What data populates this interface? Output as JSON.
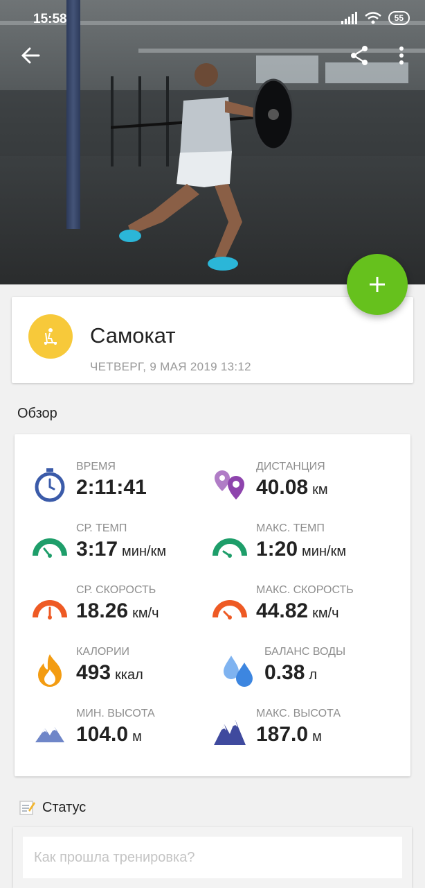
{
  "status_bar": {
    "time": "15:58",
    "battery": "55"
  },
  "header": {
    "back_icon": "arrow-left-icon",
    "share_icon": "share-icon",
    "more_icon": "more-vertical-icon"
  },
  "fab": {
    "icon": "plus-icon",
    "color": "#66c11d"
  },
  "activity": {
    "title": "Самокат",
    "date": "ЧЕТВЕРГ, 9 МАЯ 2019 13:12",
    "icon": "kick-scooter-icon",
    "icon_color": "#f7c93a"
  },
  "overview": {
    "title": "Обзор",
    "stats": [
      {
        "label": "ВРЕМЯ",
        "value": "2:11:41",
        "unit": "",
        "icon": "stopwatch-icon"
      },
      {
        "label": "ДИСТАНЦИЯ",
        "value": "40.08",
        "unit": "км",
        "icon": "map-pins-icon"
      },
      {
        "label": "СР. ТЕМП",
        "value": "3:17",
        "unit": "мин/км",
        "icon": "pace-gauge-icon"
      },
      {
        "label": "МАКС. ТЕМП",
        "value": "1:20",
        "unit": "мин/км",
        "icon": "pace-gauge-icon"
      },
      {
        "label": "СР. СКОРОСТЬ",
        "value": "18.26",
        "unit": "км/ч",
        "icon": "speed-gauge-icon"
      },
      {
        "label": "МАКС. СКОРОСТЬ",
        "value": "44.82",
        "unit": "км/ч",
        "icon": "speed-gauge-icon"
      },
      {
        "label": "КАЛОРИИ",
        "value": "493",
        "unit": "ккал",
        "icon": "flame-icon"
      },
      {
        "label": "БАЛАНС ВОДЫ",
        "value": "0.38",
        "unit": "л",
        "icon": "water-drops-icon"
      },
      {
        "label": "МИН. ВЫСОТА",
        "value": "104.0",
        "unit": "м",
        "icon": "mountain-icon"
      },
      {
        "label": "МАКС. ВЫСОТА",
        "value": "187.0",
        "unit": "м",
        "icon": "mountain-icon"
      }
    ]
  },
  "status": {
    "title": "Статус",
    "icon": "memo-icon",
    "placeholder": "Как прошла тренировка?"
  },
  "colors": {
    "green_accent": "#66c11d",
    "gauge_green": "#1e9e6a",
    "gauge_orange": "#ee5a24",
    "stopwatch_blue": "#3b5ba9",
    "pin_purple": "#8e44ad",
    "water_blue": "#4a90e2",
    "mountain_indigo": "#3f4a9e"
  }
}
